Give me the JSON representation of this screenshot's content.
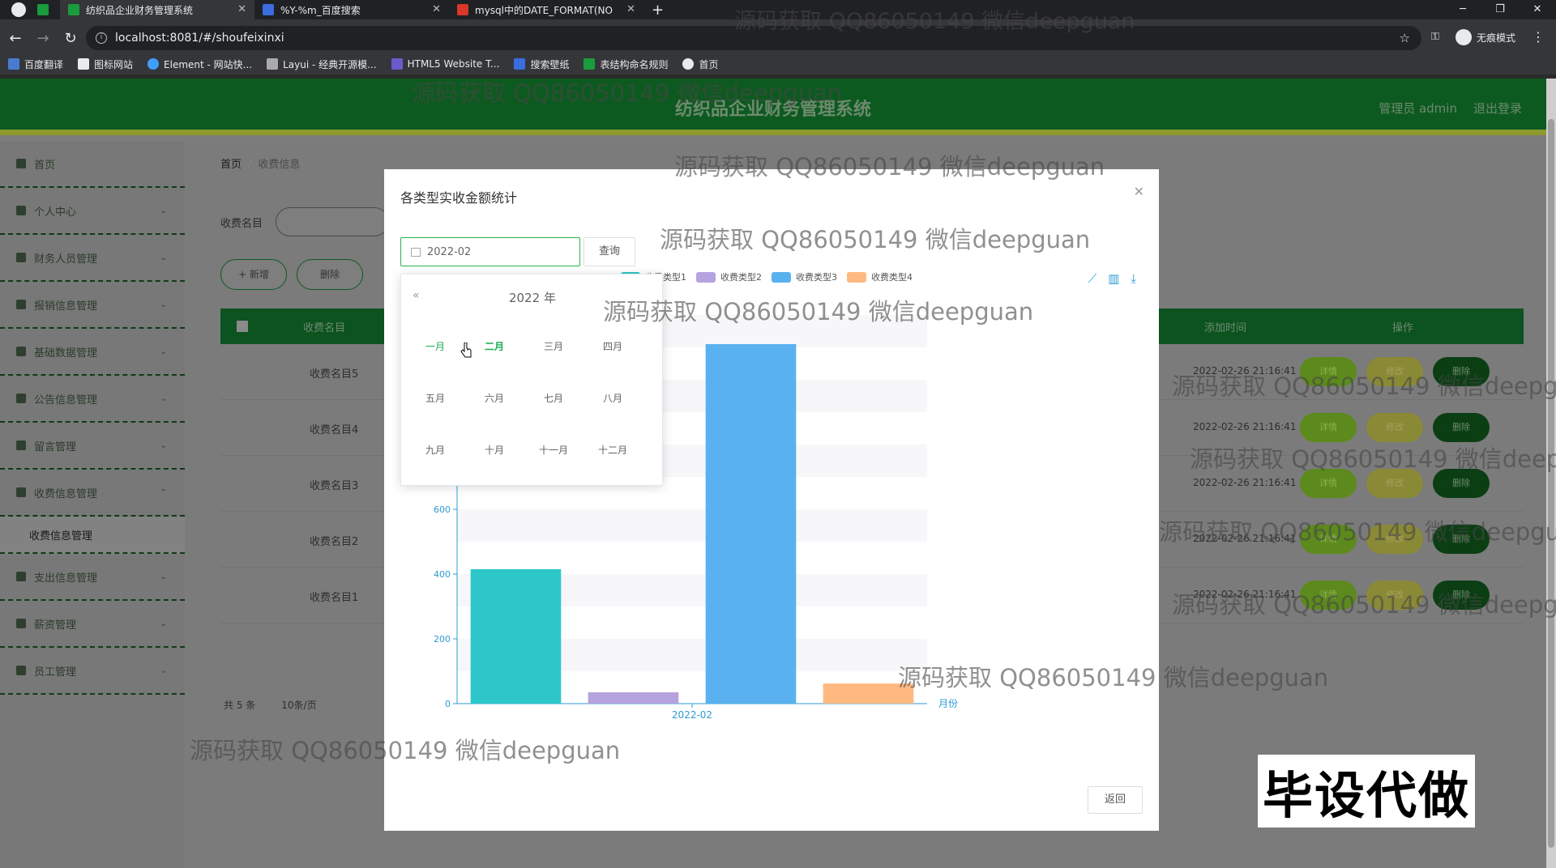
{
  "browser": {
    "tabs": [
      {
        "title": "纺织品企业财务管理系统",
        "fav": "#1a9b3c",
        "active": true
      },
      {
        "title": "%Y-%m_百度搜索",
        "fav": "#3b6de0",
        "active": false
      },
      {
        "title": "mysql中的DATE_FORMAT(NO",
        "fav": "#d8372a",
        "active": false
      }
    ],
    "url": "localhost:8081/#/shoufeixinxi",
    "incognito": "无痕模式",
    "bookmarks": [
      "百度翻译",
      "图标网站",
      "Element - 网站快...",
      "Layui - 经典开源模...",
      "HTML5 Website T...",
      "搜索壁纸",
      "表结构命名规则",
      "首页"
    ]
  },
  "app": {
    "title": "纺织品企业财务管理系统",
    "user": "管理员 admin",
    "logout": "退出登录",
    "sidebar": [
      "首页",
      "个人中心",
      "财务人员管理",
      "报销信息管理",
      "基础数据管理",
      "公告信息管理",
      "留言管理",
      "收费信息管理",
      "收费信息管理",
      "支出信息管理",
      "薪资管理",
      "员工管理"
    ],
    "breadcrumb": {
      "home": "首页",
      "sep": "/",
      "current": "收费信息"
    },
    "filter_label": "收费名目",
    "add_button": "+ 新增",
    "delete_button": "删除",
    "table": {
      "headers": [
        "收费名目",
        "添加时间",
        "操作"
      ],
      "rows": [
        {
          "name": "收费名目5",
          "time": "2022-02-26 21:16:41"
        },
        {
          "name": "收费名目4",
          "time": "2022-02-26 21:16:41"
        },
        {
          "name": "收费名目3",
          "time": "2022-02-26 21:16:41"
        },
        {
          "name": "收费名目2",
          "time": "2022-02-26 21:16:41"
        },
        {
          "name": "收费名目1",
          "time": "2022-02-26 21:16:41"
        }
      ],
      "actions": [
        "详情",
        "修改",
        "删除"
      ]
    },
    "pagination": {
      "total": "共 5 条",
      "size": "10条/页"
    }
  },
  "modal": {
    "title": "各类型实收金额统计",
    "date_value": "2022-02",
    "query": "查询",
    "return": "返回",
    "picker": {
      "year": "2022 年",
      "months": [
        "一月",
        "二月",
        "三月",
        "四月",
        "五月",
        "六月",
        "七月",
        "八月",
        "九月",
        "十月",
        "十一月",
        "十二月"
      ],
      "selected_index": 1,
      "current_index": 0
    }
  },
  "chart_data": {
    "type": "bar",
    "title": "",
    "xlabel": "月份",
    "ylabel": "",
    "categories": [
      "2022-02"
    ],
    "series": [
      {
        "name": "收费类型1",
        "values": [
          415
        ],
        "color": "#2ec7c9"
      },
      {
        "name": "收费类型2",
        "values": [
          35
        ],
        "color": "#b6a2de"
      },
      {
        "name": "收费类型3",
        "values": [
          1110
        ],
        "color": "#5ab1ef"
      },
      {
        "name": "收费类型4",
        "values": [
          62
        ],
        "color": "#ffb980"
      }
    ],
    "ylim": [
      0,
      1200
    ],
    "yticks": [
      0,
      200,
      400,
      600
    ],
    "grid": true,
    "legend": "top"
  },
  "watermarks": [
    "源码获取 QQ86050149 微信deepguan",
    "毕设代做"
  ]
}
